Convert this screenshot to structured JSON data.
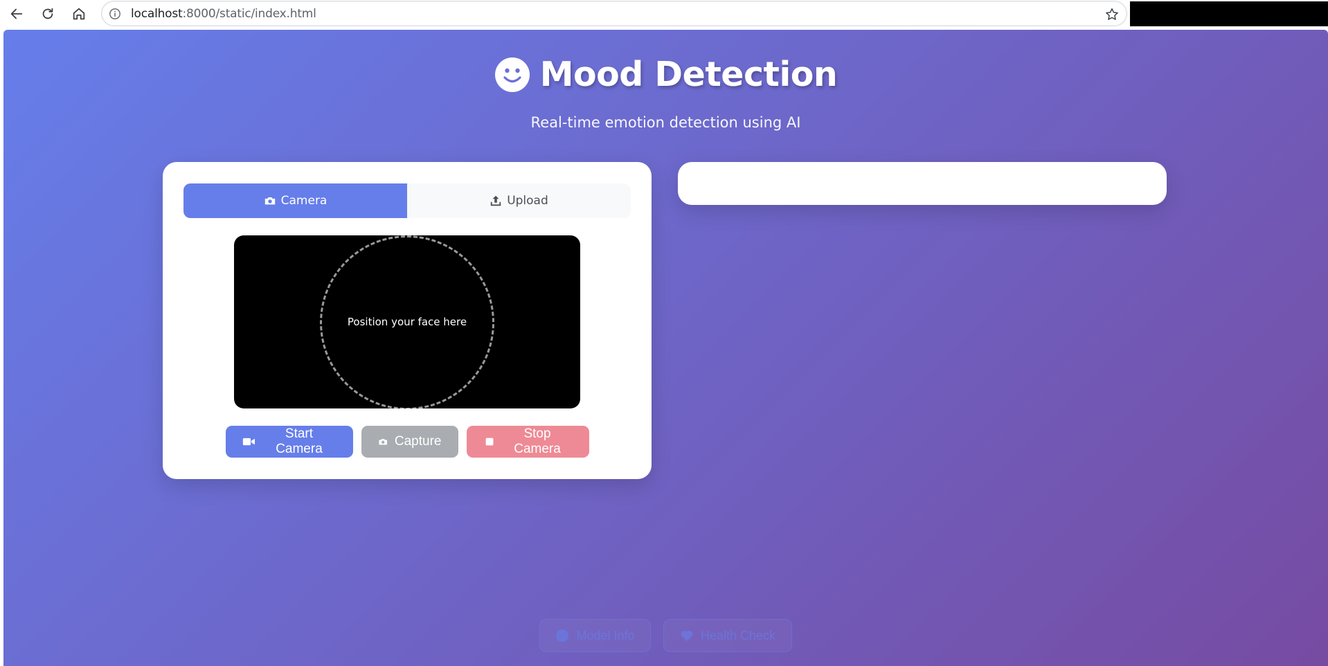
{
  "browser": {
    "url_host": "localhost",
    "url_rest": ":8000/static/index.html"
  },
  "header": {
    "title": "Mood Detection",
    "subtitle": "Real-time emotion detection using AI",
    "icon": "smile-icon"
  },
  "tabs": [
    {
      "label": "Camera",
      "icon": "camera-icon",
      "active": true
    },
    {
      "label": "Upload",
      "icon": "upload-icon",
      "active": false
    }
  ],
  "video": {
    "overlay_text": "Position your face here"
  },
  "controls": {
    "start_label": "Start Camera",
    "capture_label": "Capture",
    "stop_label": "Stop Camera"
  },
  "footer": {
    "model_info_label": "Model Info",
    "health_check_label": "Health Check"
  },
  "colors": {
    "primary": "#667eea",
    "gradient_end": "#764ba2",
    "capture": "#a9acb0",
    "stop": "#ee8a95"
  }
}
